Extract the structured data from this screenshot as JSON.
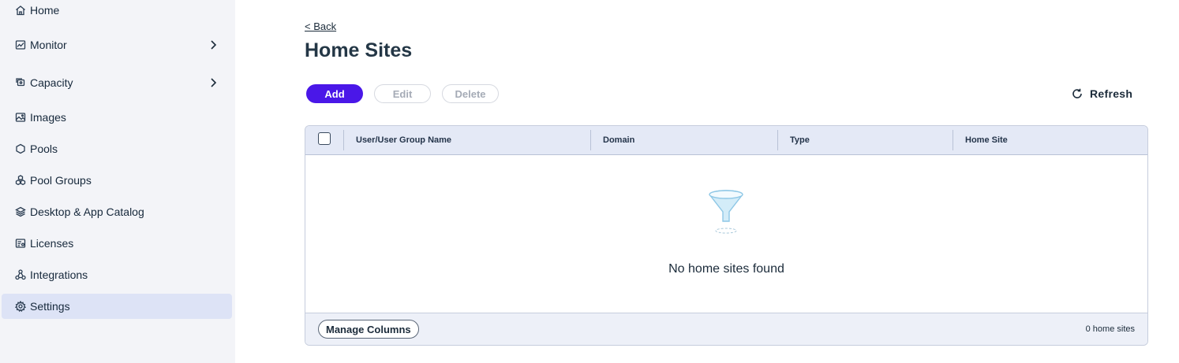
{
  "sidebar": {
    "items": [
      {
        "label": "Home",
        "icon": "home-icon",
        "chevron": false,
        "active": false
      },
      {
        "label": "Monitor",
        "icon": "monitor-icon",
        "chevron": true,
        "active": false
      },
      {
        "label": "Capacity",
        "icon": "capacity-icon",
        "chevron": true,
        "active": false
      },
      {
        "label": "Images",
        "icon": "images-icon",
        "chevron": false,
        "active": false
      },
      {
        "label": "Pools",
        "icon": "pools-icon",
        "chevron": false,
        "active": false
      },
      {
        "label": "Pool Groups",
        "icon": "pool-groups-icon",
        "chevron": false,
        "active": false
      },
      {
        "label": "Desktop & App Catalog",
        "icon": "catalog-icon",
        "chevron": false,
        "active": false
      },
      {
        "label": "Licenses",
        "icon": "licenses-icon",
        "chevron": false,
        "active": false
      },
      {
        "label": "Integrations",
        "icon": "integrations-icon",
        "chevron": false,
        "active": false
      },
      {
        "label": "Settings",
        "icon": "gear-icon",
        "chevron": false,
        "active": true
      }
    ]
  },
  "main": {
    "back_label": "< Back",
    "title": "Home Sites",
    "toolbar": {
      "add_label": "Add",
      "edit_label": "Edit",
      "delete_label": "Delete",
      "refresh_label": "Refresh"
    },
    "table": {
      "columns": [
        "User/User Group Name",
        "Domain",
        "Type",
        "Home Site"
      ],
      "empty_message": "No home sites found",
      "manage_columns_label": "Manage Columns",
      "count_label": "0 home sites"
    }
  },
  "colors": {
    "accent": "#4a17e8",
    "sidebar_bg": "#f3f4f8",
    "active_bg": "#dde3f6",
    "header_bg": "#e4e9f6"
  }
}
